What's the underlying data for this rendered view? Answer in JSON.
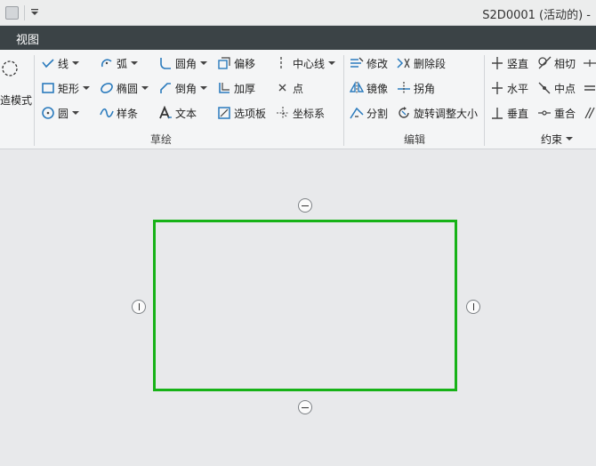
{
  "titlebar": {
    "window_title": "S2D0001 (活动的) -"
  },
  "tabs": {
    "active": "视图"
  },
  "ribbon": {
    "partial_mode_label": "造模式",
    "groups": {
      "sketch": {
        "label": "草绘",
        "line": "线",
        "arc": "弧",
        "fillet": "圆角",
        "offset": "偏移",
        "centerline": "中心线",
        "rectangle": "矩形",
        "ellipse": "椭圆",
        "chamfer": "倒角",
        "thicken": "加厚",
        "point": "点",
        "circle": "圆",
        "spline": "样条",
        "text": "文本",
        "palette": "选项板",
        "coordinate_system": "坐标系"
      },
      "edit": {
        "label": "编辑",
        "modify": "修改",
        "delete_segment": "删除段",
        "mirror": "镜像",
        "corner": "拐角",
        "divide": "分割",
        "rotate_resize": "旋转调整大小"
      },
      "constrain": {
        "label": "约束",
        "vertical": "竖直",
        "tangent": "相切",
        "horizontal": "水平",
        "midpoint": "中点",
        "perpendicular": "垂直",
        "coincident": "重合"
      }
    }
  },
  "colors": {
    "sketch_geometry": "#17b217",
    "tabbar": "#3b4346",
    "icon_blue": "#2b7bbd"
  }
}
